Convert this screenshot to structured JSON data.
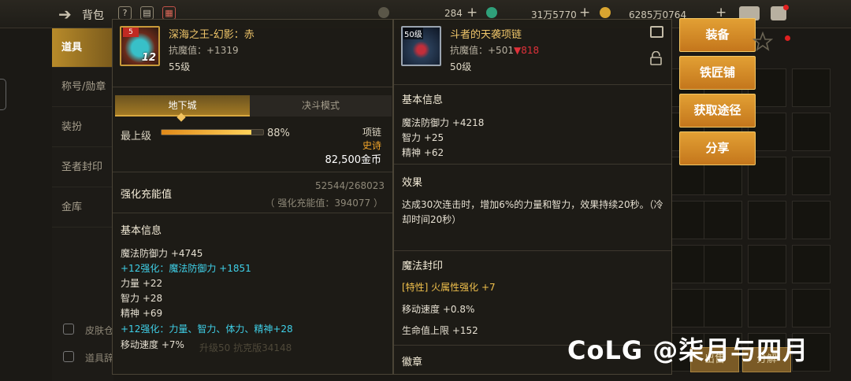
{
  "topbar": {
    "title": "背包",
    "currency1": "284",
    "currency2": "31万5770",
    "currency3": "6285万0764"
  },
  "sidebar": {
    "items": [
      "道具",
      "称号/勋章",
      "装扮",
      "圣者封印",
      "金库"
    ],
    "small1": "皮肤仓",
    "small2": "道具辞"
  },
  "left_item": {
    "name": "深海之王-幻影：赤",
    "resist": "抗魔值：+1319",
    "level": "55级",
    "badge": "12",
    "tabs": [
      "地下城",
      "决斗模式"
    ],
    "grade_label": "最上级",
    "grade_pct_text": "88%",
    "grade_fraction": 0.88,
    "type": "项链",
    "rarity": "史诗",
    "price": "82,500金币",
    "charge_title": "强化充能值",
    "charge_value": "52544/268023",
    "charge_sub": "（ 强化充能值：394077 ）",
    "basic_title": "基本信息",
    "stats": [
      "魔法防御力 +4745",
      "+12强化：魔法防御力 +1851",
      "力量 +22",
      "智力 +28",
      "精神 +69",
      "+12强化：力量、智力、体力、精神+28",
      "移动速度 +7%"
    ],
    "dim_footer": "升级50 抗克版34148"
  },
  "right_item": {
    "name": "斗者的天袭项链",
    "resist_prefix": "抗魔值：+501",
    "resist_down": "▼818",
    "level": "50级",
    "badge": "50级",
    "basic_title": "基本信息",
    "stats": [
      "魔法防御力 +4218",
      "智力 +25",
      "精神 +62"
    ],
    "effect_title": "效果",
    "effect_desc": "达成30次连击时，增加6%的力量和智力，效果持续20秒。（冷却时间20秒）",
    "seal_title": "魔法封印",
    "seal_stats": [
      "[特性] 火属性强化 +7",
      "移动速度 +0.8%",
      "生命值上限 +152"
    ],
    "emblem_title": "徽章"
  },
  "buttons": [
    "装备",
    "铁匠铺",
    "获取途径",
    "分享"
  ],
  "bottom_buttons": [
    "出售",
    "分解"
  ],
  "watermark": "CoLG @柒月与四月",
  "colors": {
    "gold_text": "#f0c66a",
    "cyan_text": "#3fd0e8",
    "button_orange": "#d88a26",
    "down_red": "#e0313a"
  }
}
